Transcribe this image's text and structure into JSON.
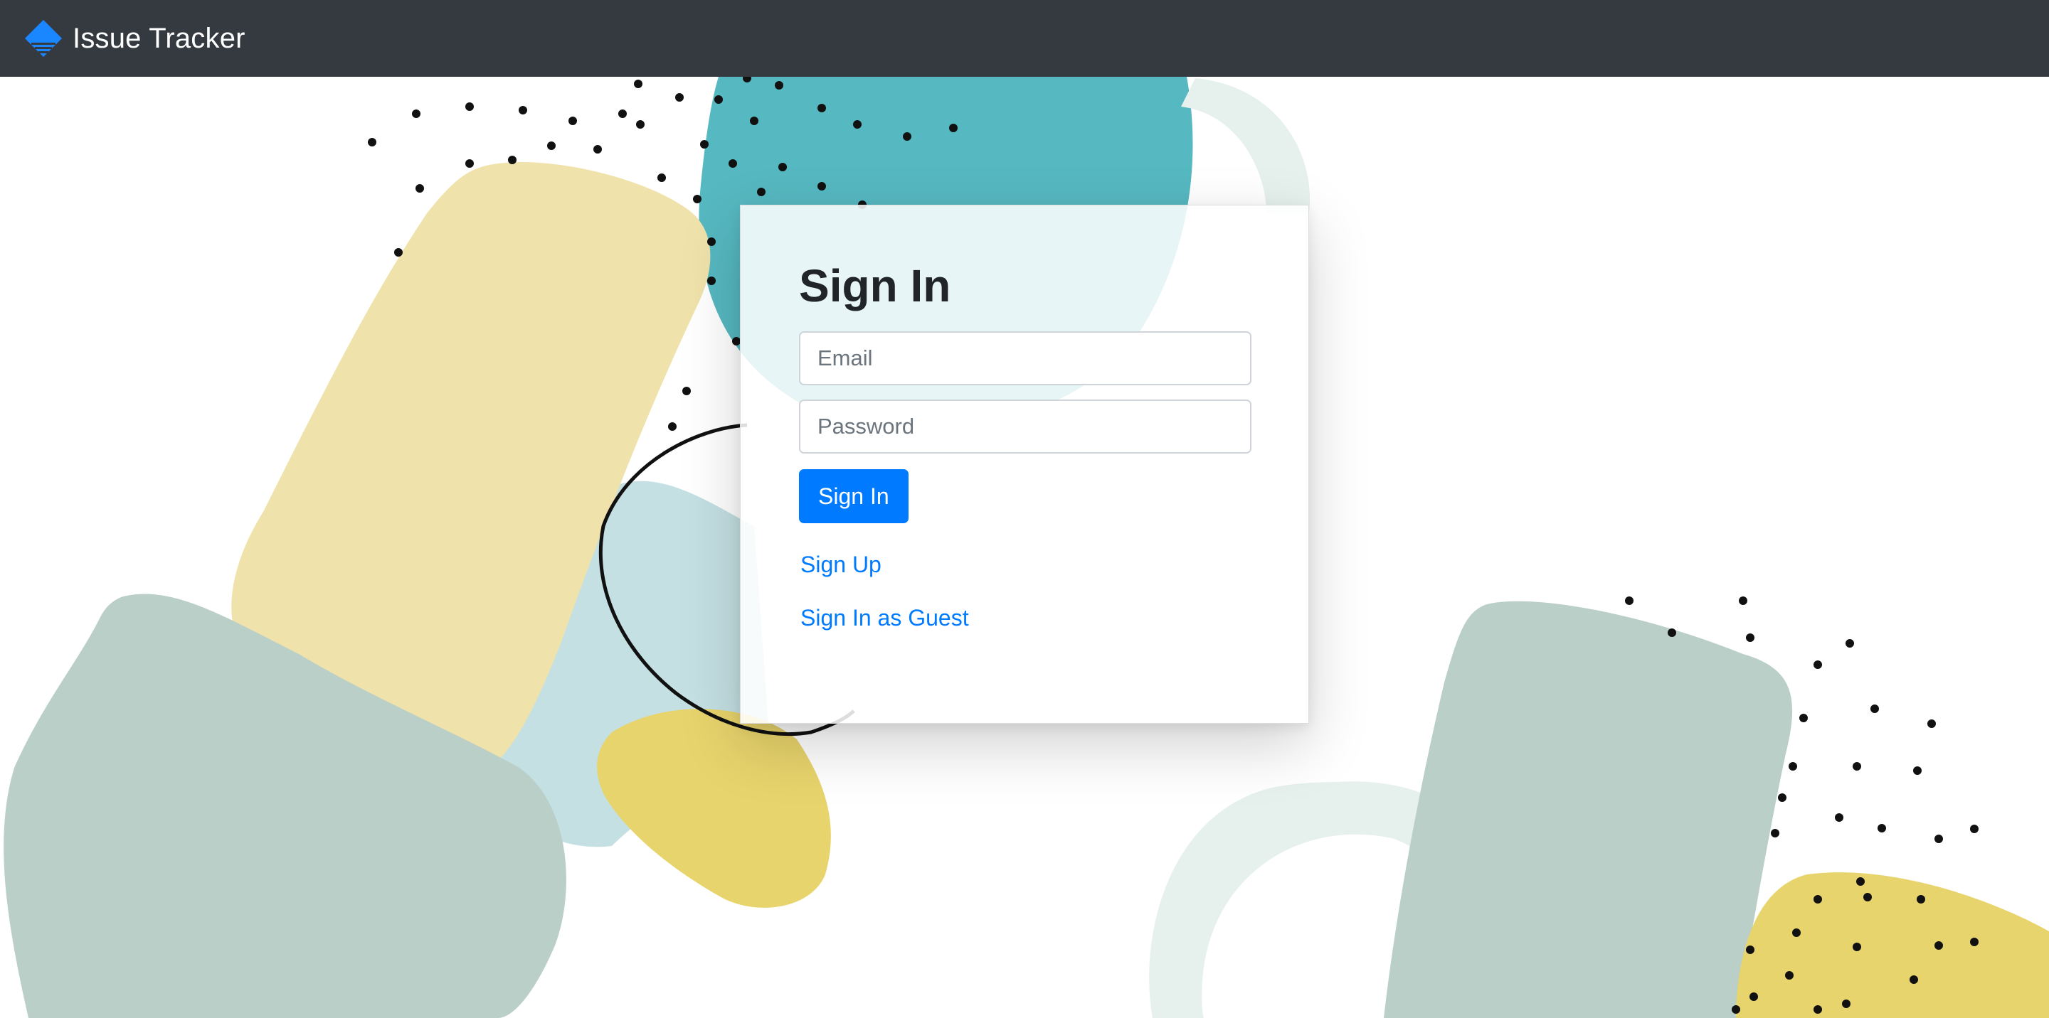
{
  "navbar": {
    "brand_text": "Issue Tracker",
    "brand_icon": "layers-icon",
    "background": "#343a40"
  },
  "signin": {
    "title": "Sign In",
    "email_placeholder": "Email",
    "email_value": "",
    "password_placeholder": "Password",
    "password_value": "",
    "submit_label": "Sign In",
    "signup_link": "Sign Up",
    "guest_link": "Sign In as Guest"
  },
  "colors": {
    "accent": "#007bff",
    "teal": "#56b8c1",
    "sand": "#f0e2ab",
    "sage": "#bacfc8",
    "mustard": "#e8d46c",
    "light_blue": "#c4e0e3"
  }
}
